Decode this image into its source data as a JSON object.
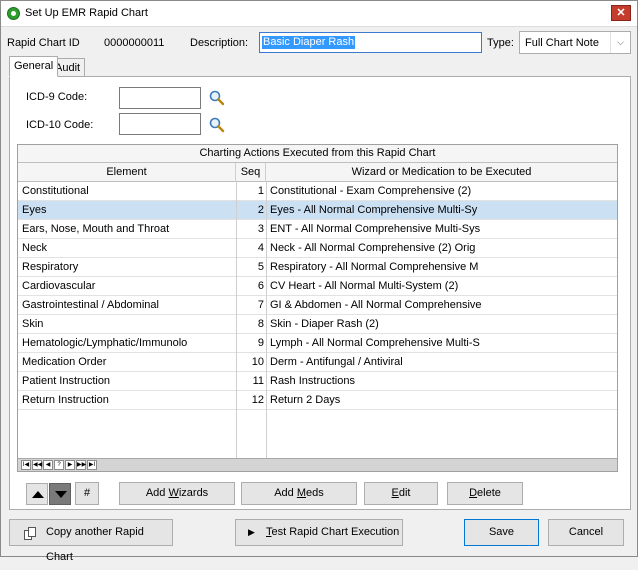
{
  "window": {
    "title": "Set Up EMR Rapid Chart",
    "close_label": "✕"
  },
  "header": {
    "rapid_chart_id_label": "Rapid Chart ID",
    "rapid_chart_id_value": "0000000011",
    "description_label": "Description:",
    "description_value": "Basic Diaper Rash",
    "type_label": "Type:",
    "type_value": "Full Chart Note"
  },
  "tabs": [
    {
      "label": "General",
      "active": true
    },
    {
      "label": "Audit",
      "active": false
    }
  ],
  "codes": {
    "icd9_label": "ICD-9 Code:",
    "icd9_value": "",
    "icd10_label": "ICD-10 Code:",
    "icd10_value": ""
  },
  "grid": {
    "caption": "Charting Actions Executed from this Rapid Chart",
    "columns": [
      "Element",
      "Seq",
      "Wizard or Medication to be Executed"
    ],
    "selected_row": 1,
    "rows": [
      {
        "element": "Constitutional",
        "seq": "1",
        "wizard": "Constitutional - Exam Comprehensive (2)"
      },
      {
        "element": "Eyes",
        "seq": "2",
        "wizard": "Eyes - All Normal Comprehensive Multi-Sy"
      },
      {
        "element": "Ears, Nose, Mouth and Throat",
        "seq": "3",
        "wizard": "ENT - All Normal Comprehensive Multi-Sys"
      },
      {
        "element": "Neck",
        "seq": "4",
        "wizard": "Neck - All Normal Comprehensive (2) Orig"
      },
      {
        "element": "Respiratory",
        "seq": "5",
        "wizard": "Respiratory - All Normal Comprehensive M"
      },
      {
        "element": "Cardiovascular",
        "seq": "6",
        "wizard": "CV Heart - All Normal Multi-System (2)"
      },
      {
        "element": "Gastrointestinal / Abdominal",
        "seq": "7",
        "wizard": "GI & Abdomen - All Normal Comprehensive"
      },
      {
        "element": "Skin",
        "seq": "8",
        "wizard": "Skin - Diaper Rash (2)"
      },
      {
        "element": "Hematologic/Lymphatic/Immunolo",
        "seq": "9",
        "wizard": "Lymph - All Normal Comprehensive Multi-S"
      },
      {
        "element": "Medication Order",
        "seq": "10",
        "wizard": "Derm - Antifungal / Antiviral"
      },
      {
        "element": "Patient Instruction",
        "seq": "11",
        "wizard": "Rash Instructions"
      },
      {
        "element": "Return Instruction",
        "seq": "12",
        "wizard": "Return 2 Days"
      }
    ],
    "nav_buttons": [
      "I◀",
      "◀◀",
      "◀",
      "?",
      "▶",
      "▶▶",
      "▶I"
    ]
  },
  "actions": {
    "hash_label": "#",
    "add_wizards_pre": "Add ",
    "add_wizards_key": "W",
    "add_wizards_post": "izards",
    "add_meds_pre": "Add ",
    "add_meds_key": "M",
    "add_meds_post": "eds",
    "edit_key": "E",
    "edit_post": "dit",
    "delete_key": "D",
    "delete_post": "elete"
  },
  "footer": {
    "copy_label": "Copy another Rapid Chart",
    "test_key": "T",
    "test_post": "est Rapid Chart Execution",
    "save_label": "Save",
    "cancel_label": "Cancel"
  },
  "colors": {
    "selection": "#cce0f4",
    "accent": "#0078d7",
    "close": "#c43c2c"
  }
}
